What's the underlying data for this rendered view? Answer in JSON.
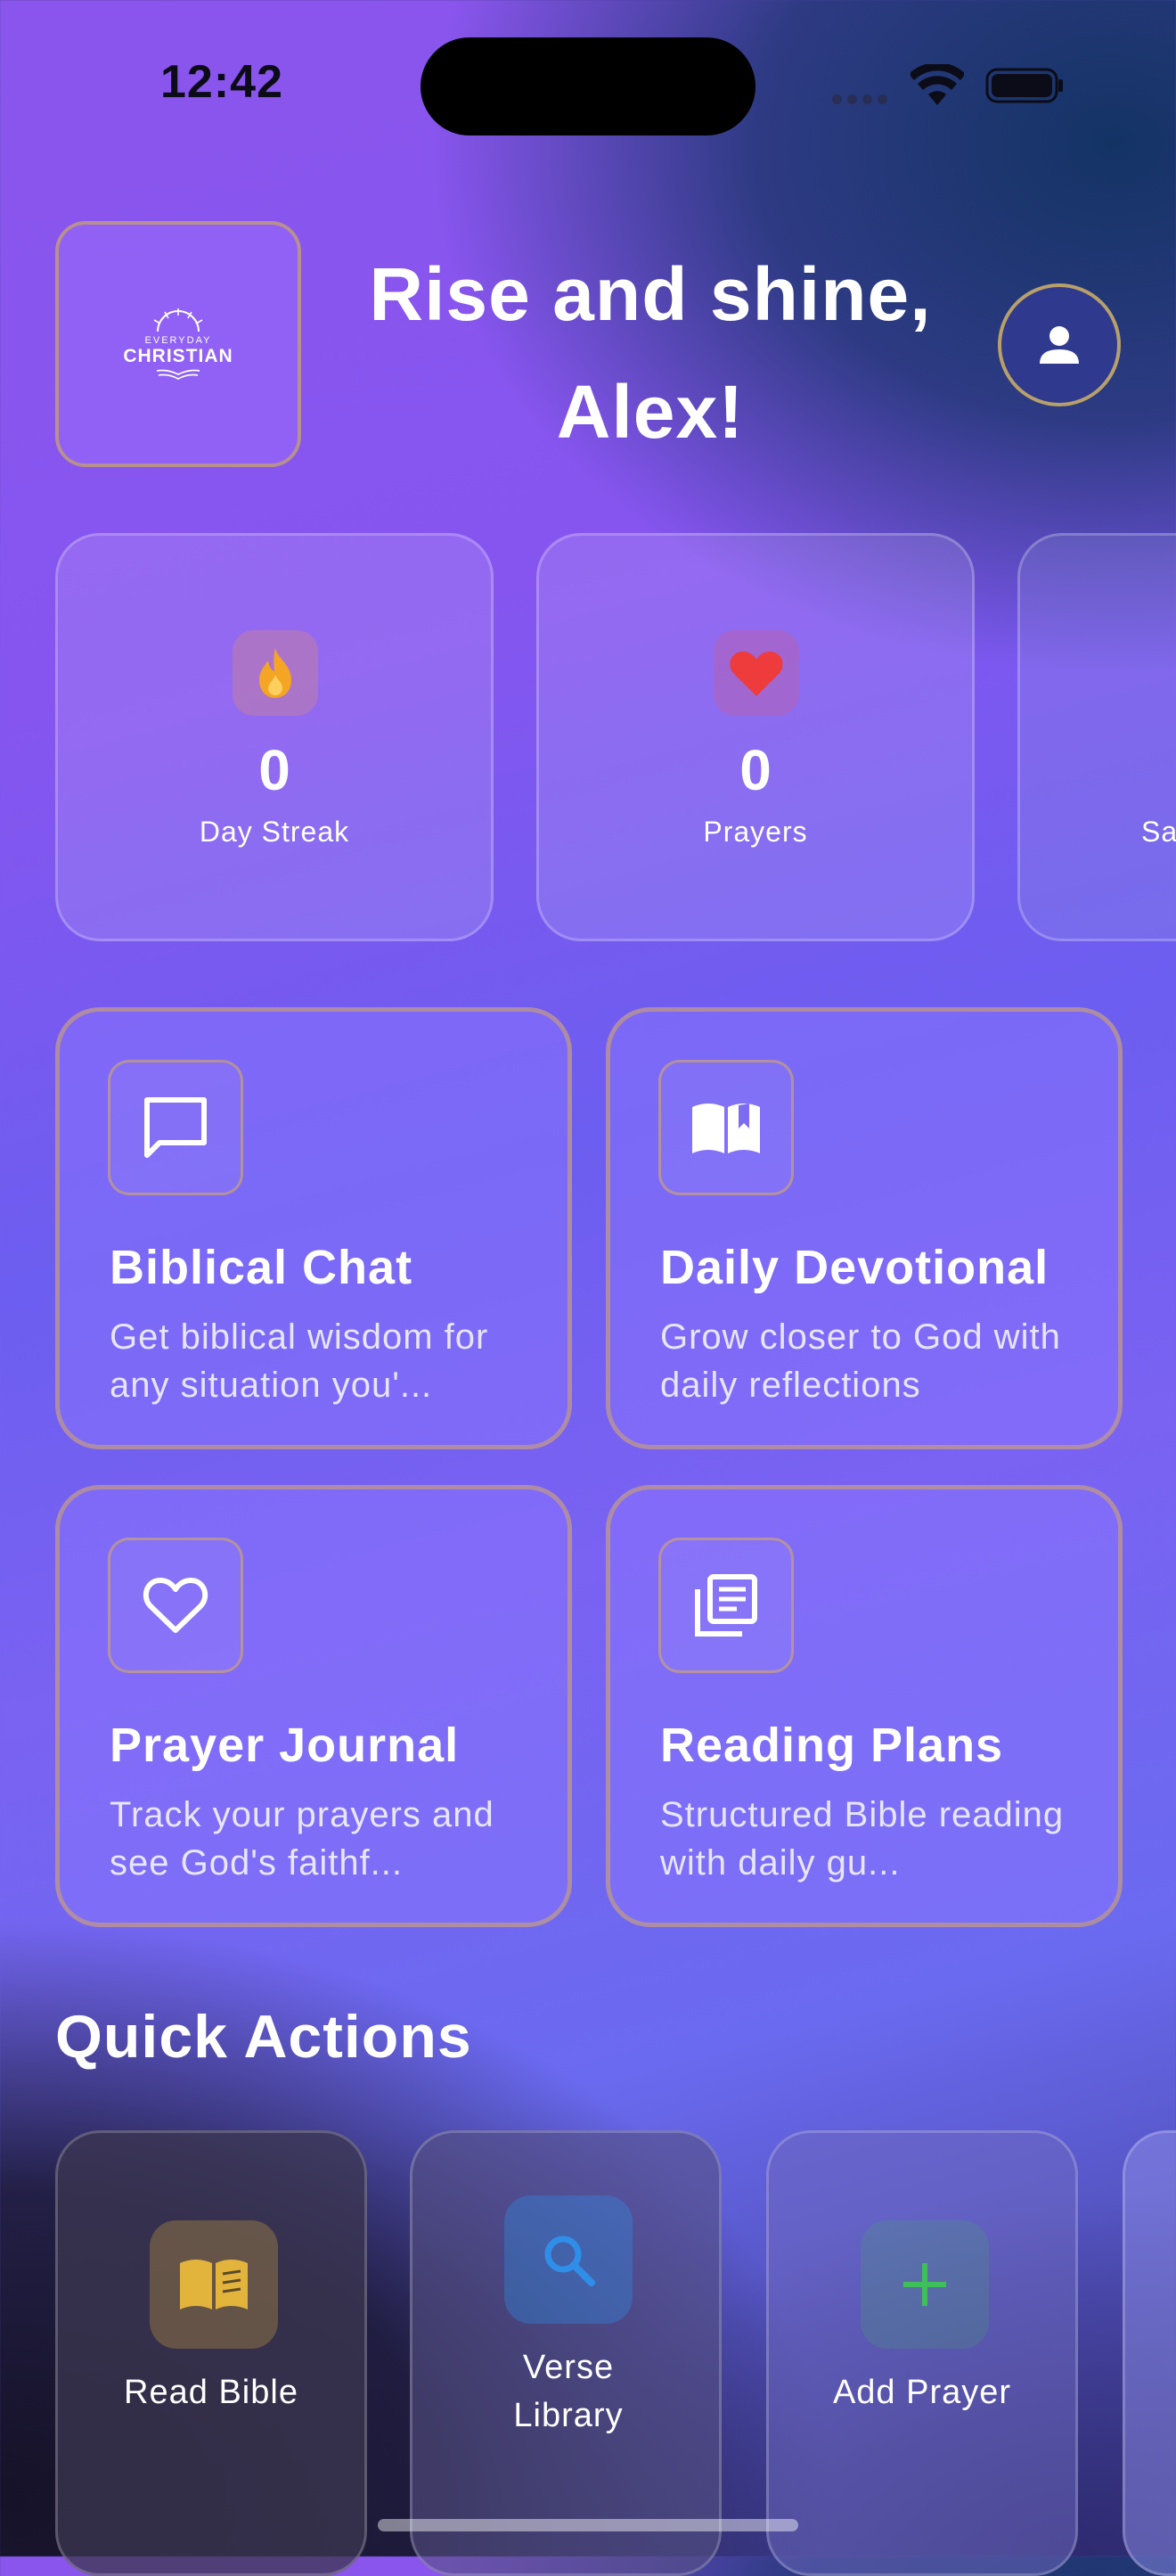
{
  "status_bar": {
    "time": "12:42"
  },
  "header": {
    "logo_top": "EVERYDAY",
    "logo_main": "CHRISTIAN",
    "greeting_line1": "Rise and shine,",
    "greeting_line2": "Alex!"
  },
  "stats": [
    {
      "value": "0",
      "label": "Day Streak",
      "icon": "flame-icon",
      "color": "#f5a524"
    },
    {
      "value": "0",
      "label": "Prayers",
      "icon": "heart-icon",
      "color": "#ee3b3b"
    },
    {
      "value": "",
      "label": "Sa",
      "icon": "",
      "color": ""
    }
  ],
  "features": [
    {
      "title": "Biblical Chat",
      "desc": "Get biblical wisdom for any situation you'...",
      "icon": "chat-bubble-icon"
    },
    {
      "title": "Daily Devotional",
      "desc": "Grow closer to God with daily reflections",
      "icon": "open-book-icon"
    },
    {
      "title": "Prayer Journal",
      "desc": "Track your prayers and see God's faithf...",
      "icon": "heart-outline-icon"
    },
    {
      "title": "Reading Plans",
      "desc": "Structured Bible reading with daily gu...",
      "icon": "documents-icon"
    }
  ],
  "quick_actions": {
    "title": "Quick Actions",
    "items": [
      {
        "label": "Read Bible",
        "icon": "book-icon",
        "color": "#e3b43c"
      },
      {
        "label": "Verse Library",
        "icon": "search-icon",
        "color": "#2f8fe8"
      },
      {
        "label": "Add Prayer",
        "icon": "plus-icon",
        "color": "#3fbf5a"
      }
    ]
  }
}
